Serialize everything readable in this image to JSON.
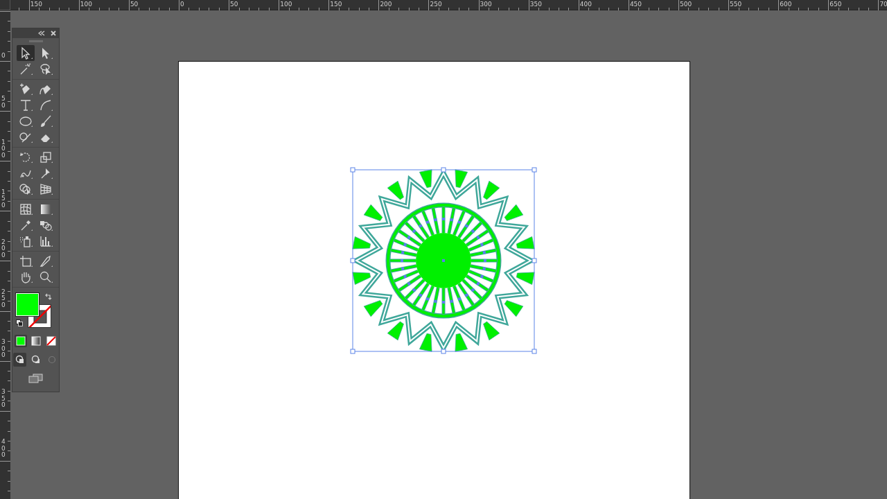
{
  "rulers": {
    "horizontal_labels": [
      "150",
      "100",
      "50",
      "0",
      "50",
      "100",
      "150",
      "200",
      "250",
      "300",
      "350",
      "400",
      "450",
      "500",
      "550",
      "600",
      "650",
      "70"
    ],
    "vertical_labels": [
      "0",
      "50",
      "100",
      "150",
      "200",
      "250",
      "300",
      "350",
      "400"
    ]
  },
  "tool_groups": [
    [
      {
        "kind": "selection",
        "selected": true
      },
      {
        "kind": "direct",
        "selected": false
      },
      {
        "kind": "wand",
        "selected": false
      },
      {
        "kind": "lasso",
        "selected": false
      }
    ],
    [
      {
        "kind": "pen",
        "selected": false
      },
      {
        "kind": "curvature",
        "selected": false
      },
      {
        "kind": "type",
        "selected": false
      },
      {
        "kind": "arc",
        "selected": false
      },
      {
        "kind": "ellipse",
        "selected": false
      },
      {
        "kind": "brush",
        "selected": false
      },
      {
        "kind": "shaper",
        "selected": false
      },
      {
        "kind": "eraser",
        "selected": false
      }
    ],
    [
      {
        "kind": "rotate",
        "selected": false
      },
      {
        "kind": "scale",
        "selected": false
      },
      {
        "kind": "puppet",
        "selected": false
      },
      {
        "kind": "pin",
        "selected": false
      },
      {
        "kind": "builder",
        "selected": false
      },
      {
        "kind": "perspective",
        "selected": false
      }
    ],
    [
      {
        "kind": "mesh",
        "selected": false
      },
      {
        "kind": "gradient",
        "selected": false
      },
      {
        "kind": "eyedropper",
        "selected": false
      },
      {
        "kind": "blend",
        "selected": false
      },
      {
        "kind": "sprayer",
        "selected": false
      },
      {
        "kind": "graph",
        "selected": false
      }
    ],
    [
      {
        "kind": "artboard",
        "selected": false
      },
      {
        "kind": "knife",
        "selected": false
      },
      {
        "kind": "hand",
        "selected": false
      },
      {
        "kind": "zoom",
        "selected": false
      }
    ]
  ],
  "color_modes": [
    {
      "kind": "color",
      "selected": true
    },
    {
      "kind": "gradient",
      "selected": false
    },
    {
      "kind": "none",
      "selected": false
    }
  ],
  "draw_modes": [
    {
      "kind": "normal",
      "selected": true
    },
    {
      "kind": "behind",
      "selected": false
    },
    {
      "kind": "inside",
      "selected": false
    }
  ]
}
